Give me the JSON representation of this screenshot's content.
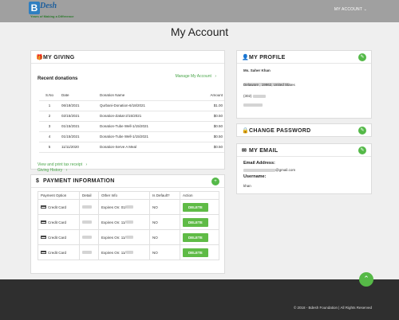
{
  "brand": {
    "mark": "B",
    "name": "Desh",
    "tagline": "Years of Making a Difference"
  },
  "nav": {
    "account_menu": "MY ACCOUNT",
    "caret": "⌄"
  },
  "page_title": "My Account",
  "my_giving": {
    "title": "MY GIVING",
    "manage_link": "Manage My Account",
    "recent_title": "Recent donations",
    "columns": [
      "S.No",
      "Date",
      "Donation Name",
      "Amount"
    ],
    "rows": [
      [
        "1",
        "06/18/2021",
        "Qurbani-Donation-6/18/2021",
        "$1.00"
      ],
      [
        "2",
        "02/15/2021",
        "Donation-Zakat-2/15/2021",
        "$0.50"
      ],
      [
        "3",
        "01/15/2021",
        "Donation-Tube Well-1/15/2021",
        "$0.50"
      ],
      [
        "4",
        "01/15/2021",
        "Donation-Tube Well-1/15/2021",
        "$0.50"
      ],
      [
        "5",
        "11/11/2020",
        "Donation-Serve A Meal",
        "$0.50"
      ]
    ],
    "view_print_link": "View and print tax receipt",
    "history_link": "Giving History",
    "arrow": "›"
  },
  "payment": {
    "title": "PAYMENT INFORMATION",
    "columns": [
      "Payment Option",
      "Detail",
      "Other Info",
      "Is Default?",
      "Action"
    ],
    "rows": [
      {
        "option": "Credit Card",
        "other": "Expires On: 01/",
        "default": "NO",
        "action": "DELETE"
      },
      {
        "option": "Credit Card",
        "other": "Expires On: 11/",
        "default": "NO",
        "action": "DELETE"
      },
      {
        "option": "Credit Card",
        "other": "Expires On: 11/",
        "default": "NO",
        "action": "DELETE"
      },
      {
        "option": "Credit Card",
        "other": "Expires On: 11/",
        "default": "NO",
        "action": "DELETE"
      }
    ]
  },
  "profile": {
    "title": "MY PROFILE",
    "name": "Ms. Saher Khan",
    "city_line": "Delaware , 19962, United States",
    "phone_prefix": "(302)"
  },
  "password": {
    "title": "CHANGE PASSWORD"
  },
  "email": {
    "title": "MY EMAIL",
    "address_label": "Email Address:",
    "address_domain": "@gmail.com",
    "username_label": "Username:",
    "username": "khan"
  },
  "footer": {
    "text": "© 2018 - Bdesh Foundation | All Rights Reserved"
  },
  "colors": {
    "accent_green": "#54b948",
    "topbar": "#a0a0a0",
    "footer": "#2f2f2f"
  }
}
